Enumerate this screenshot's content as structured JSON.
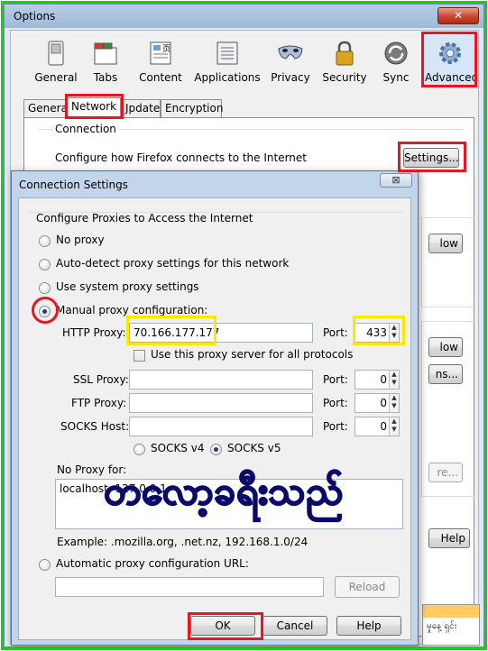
{
  "options_window": {
    "title": "Options",
    "close_glyph": "✕",
    "panes": [
      {
        "label": "General",
        "icon": "general-switch-icon"
      },
      {
        "label": "Tabs",
        "icon": "tabs-icon"
      },
      {
        "label": "Content",
        "icon": "content-icon"
      },
      {
        "label": "Applications",
        "icon": "applications-icon"
      },
      {
        "label": "Privacy",
        "icon": "privacy-mask-icon"
      },
      {
        "label": "Security",
        "icon": "security-lock-icon"
      },
      {
        "label": "Sync",
        "icon": "sync-icon"
      },
      {
        "label": "Advanced",
        "icon": "advanced-gear-icon"
      }
    ],
    "selected_pane": "Advanced",
    "subtabs": [
      "General",
      "Network",
      "Update",
      "Encryption"
    ],
    "subtab_labels_visible": [
      "General",
      "Network",
      "Jpdate",
      "Encryption"
    ],
    "active_subtab": "Network",
    "connection": {
      "heading": "Connection",
      "description": "Configure how Firefox connects to the Internet",
      "settings_button": "Settings..."
    },
    "background_partial_buttons": [
      "low",
      "low",
      "ns...",
      "re...",
      "Help"
    ],
    "background_text_fragment": "မှုနေ့ ရှင်း"
  },
  "connection_settings": {
    "title": "Connection Settings",
    "close_glyph": "⊠",
    "group_label": "Configure Proxies to Access the Internet",
    "options": {
      "no_proxy": "No proxy",
      "auto_detect": "Auto-detect proxy settings for this network",
      "system": "Use system proxy settings",
      "manual": "Manual proxy configuration:",
      "auto_url": "Automatic proxy configuration URL:"
    },
    "selected_option": "manual",
    "http_proxy": {
      "label": "HTTP Proxy:",
      "value": "70.166.177.177",
      "port_label": "Port:",
      "port": "433"
    },
    "same_proxy_checkbox": {
      "label": "Use this proxy server for all protocols",
      "checked": false
    },
    "ssl_proxy": {
      "label": "SSL Proxy:",
      "value": "",
      "port_label": "Port:",
      "port": "0"
    },
    "ftp_proxy": {
      "label": "FTP Proxy:",
      "value": "",
      "port_label": "Port:",
      "port": "0"
    },
    "socks_host": {
      "label": "SOCKS Host:",
      "value": "",
      "port_label": "Port:",
      "port": "0"
    },
    "socks_versions": {
      "v4": "SOCKS v4",
      "v5": "SOCKS v5",
      "selected": "v5"
    },
    "no_proxy_for": {
      "label": "No Proxy for:",
      "value": "localhost, 127.0.0.1"
    },
    "example": "Example: .mozilla.org, .net.nz, 192.168.1.0/24",
    "auto_url_value": "",
    "reload_button": "Reload",
    "ok_button": "OK",
    "cancel_button": "Cancel",
    "help_button": "Help"
  },
  "overlay_text": "တလော့ခရီးသည်",
  "annotation_colors": {
    "red": "#e8161e",
    "yellow": "#ffe800",
    "green": "#17d017"
  }
}
